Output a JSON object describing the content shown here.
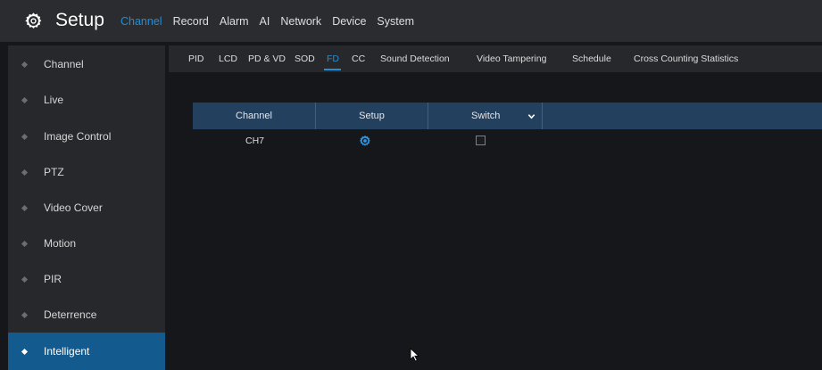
{
  "app": {
    "title": "Setup",
    "logo_icon": "gear-icon"
  },
  "topmenu": {
    "items": [
      "Channel",
      "Record",
      "Alarm",
      "AI",
      "Network",
      "Device",
      "System"
    ],
    "active": "Channel",
    "active_color": "#1f8fd8"
  },
  "sidebar": {
    "items": [
      "Channel",
      "Live",
      "Image Control",
      "PTZ",
      "Video Cover",
      "Motion",
      "PIR",
      "Deterrence",
      "Intelligent"
    ],
    "active": "Intelligent",
    "active_color": "#135a8f"
  },
  "subtabs": {
    "items": [
      "PID",
      "LCD",
      "PD & VD",
      "SOD",
      "FD",
      "CC",
      "Sound Detection",
      "Video Tampering",
      "Schedule",
      "Cross Counting Statistics"
    ],
    "active": "FD"
  },
  "table": {
    "headers": [
      "Channel",
      "Setup",
      "Switch"
    ],
    "switch_dropdown_icon": "chevron-down-icon",
    "rows": [
      {
        "channel": "CH7",
        "setup_icon": "gear-icon",
        "switch_checked": false
      }
    ]
  },
  "colors": {
    "background": "#16171a",
    "panel": "#26282c",
    "table_header": "#23405e"
  }
}
